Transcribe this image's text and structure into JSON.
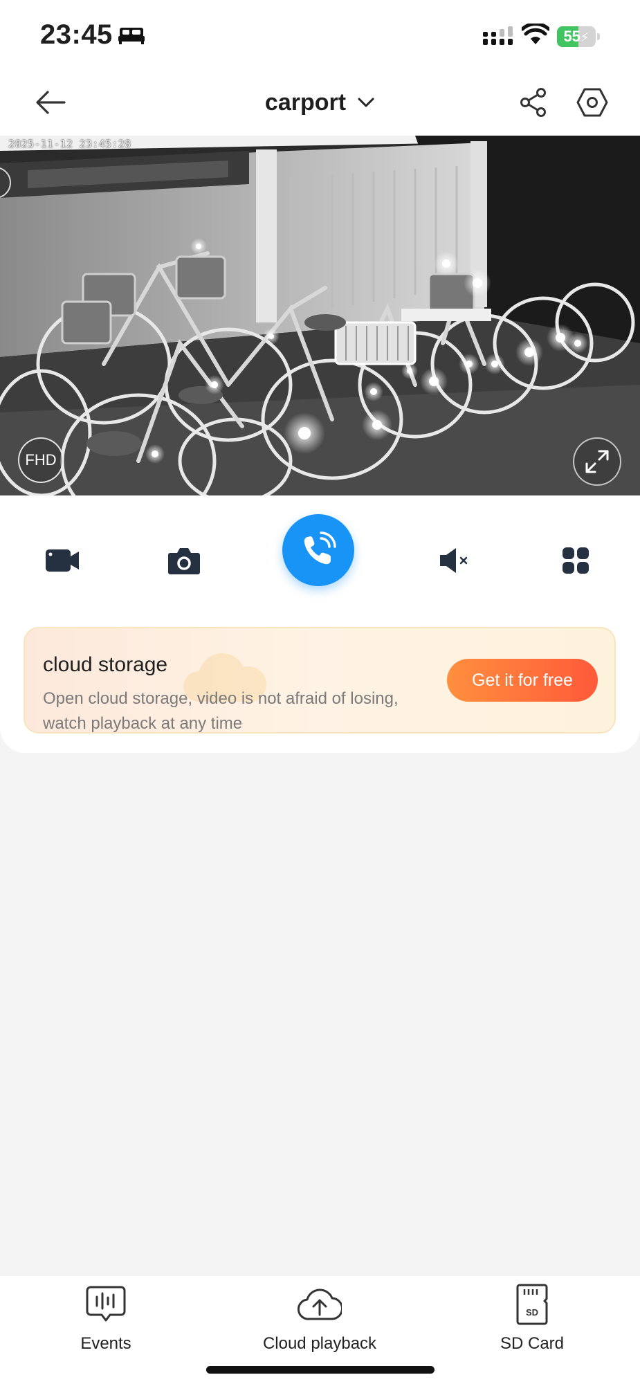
{
  "status_bar": {
    "time": "23:45",
    "battery_level": "55",
    "battery_fraction": 0.55,
    "icons": [
      "sleep-focus-icon",
      "cellular-signal-icon",
      "wifi-icon",
      "battery-charging-icon"
    ]
  },
  "header": {
    "title": "carport",
    "icons": [
      "back-arrow-icon",
      "chevron-down-icon",
      "share-icon",
      "settings-hexagon-icon"
    ]
  },
  "video": {
    "timestamp": "2025-11-12 23:45:28",
    "quality": "FHD",
    "icons": [
      "fullscreen-expand-icon"
    ]
  },
  "controls": {
    "icons": [
      "record-video-icon",
      "snapshot-camera-icon",
      "talk-phone-icon",
      "speaker-muted-icon",
      "more-grid-icon"
    ],
    "accent_color": "#1893f6"
  },
  "cloud_banner": {
    "title": "cloud storage",
    "description": "Open cloud storage, video is not afraid of losing, watch playback at any time",
    "button_label": "Get it for free",
    "button_color": "#ff6a3c"
  },
  "tabs": [
    {
      "label": "Events",
      "icon": "events-chart-icon"
    },
    {
      "label": "Cloud playback",
      "icon": "cloud-upload-icon"
    },
    {
      "label": "SD Card",
      "icon": "sd-card-icon"
    }
  ]
}
